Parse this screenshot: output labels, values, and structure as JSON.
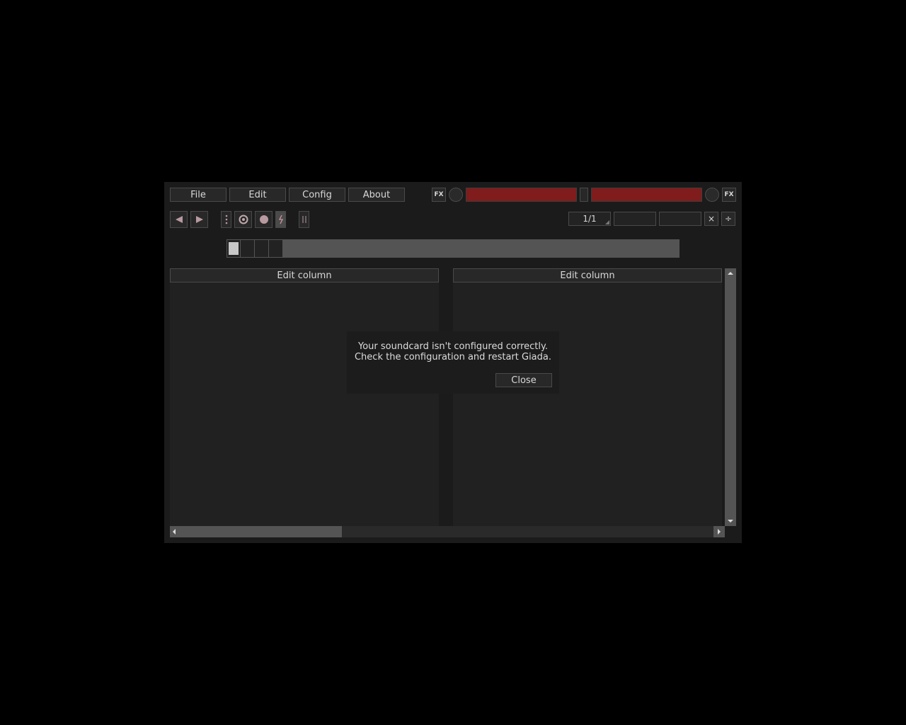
{
  "menu": {
    "file": "File",
    "edit": "Edit",
    "config": "Config",
    "about": "About"
  },
  "master": {
    "fx_in_label": "FX",
    "fx_out_label": "FX",
    "meter_color": "#801c1c"
  },
  "transport": {
    "rewind_icon": "rewind-icon",
    "play_icon": "play-icon",
    "record_input_icon": "record-input-icon",
    "record_actions_icon": "record-actions-icon",
    "metronome_icon": "metronome-icon"
  },
  "timing": {
    "beats_bars": "1/1",
    "bpm": "",
    "quantize": "",
    "multiply_label": "×",
    "divide_label": "÷"
  },
  "beat_meter": {
    "beats": 4,
    "current_beat": 1
  },
  "columns": [
    {
      "edit_label": "Edit column"
    },
    {
      "edit_label": "Edit column"
    }
  ],
  "dialog": {
    "line1": "Your soundcard isn't configured correctly.",
    "line2": "Check the configuration and restart Giada.",
    "close_label": "Close"
  },
  "scrollbars": {
    "horizontal_position": 0.0,
    "horizontal_visible_fraction": 0.31
  }
}
